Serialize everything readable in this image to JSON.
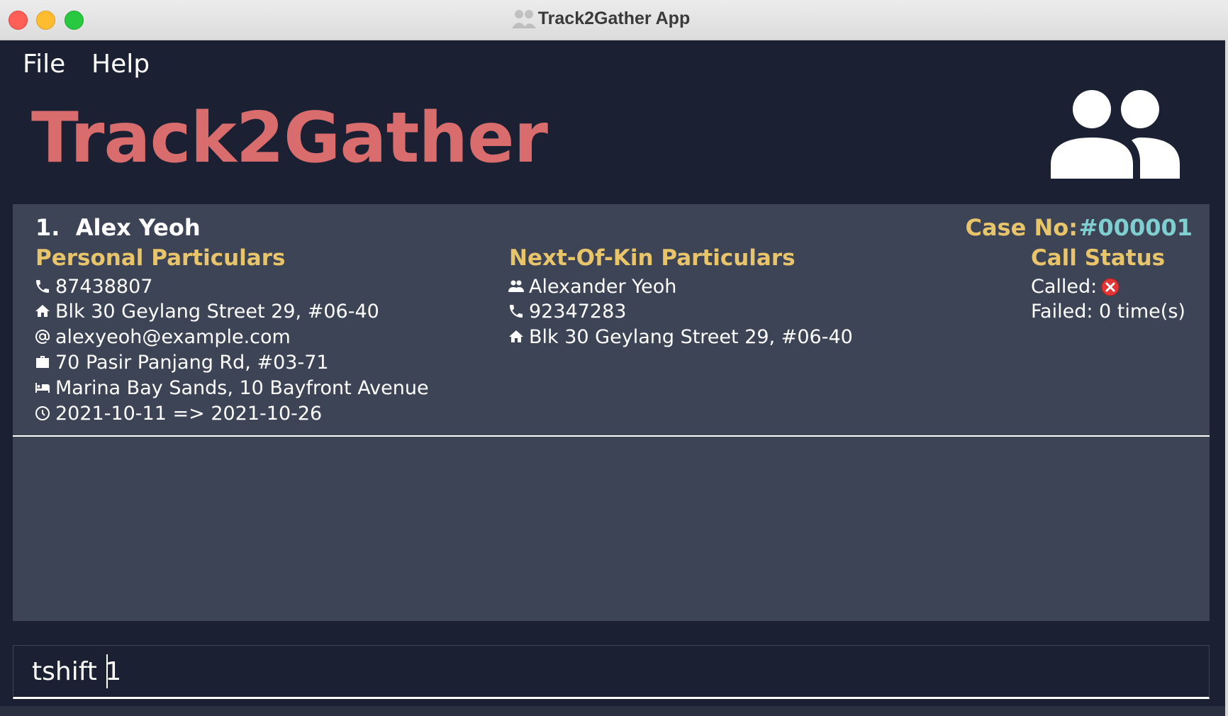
{
  "window": {
    "title": "Track2Gather App"
  },
  "menu": {
    "items": [
      {
        "label": "File"
      },
      {
        "label": "Help"
      }
    ]
  },
  "header": {
    "app_name": "Track2Gather",
    "logo_icon": "people-icon"
  },
  "colors": {
    "background": "#1b2032",
    "panel": "#3d4455",
    "title_red": "#d96d6d",
    "heading_yellow": "#e8c46a",
    "case_teal": "#7fcfd0",
    "status_red": "#e23636"
  },
  "person": {
    "index": "1.",
    "name": "Alex Yeoh",
    "case_label": "Case No:",
    "case_number": "#000001",
    "personal": {
      "heading": "Personal Particulars",
      "phone": "87438807",
      "address": "Blk 30 Geylang Street 29, #06-40",
      "email": "alexyeoh@example.com",
      "work_address": "70 Pasir Panjang Rd, #03-71",
      "quarantine_address": "Marina Bay Sands, 10 Bayfront Avenue",
      "shn_period": "2021-10-11 => 2021-10-26"
    },
    "next_of_kin": {
      "heading": "Next-Of-Kin Particulars",
      "name": "Alexander Yeoh",
      "phone": "92347283",
      "address": "Blk 30 Geylang Street 29, #06-40"
    },
    "call_status": {
      "heading": "Call Status",
      "called_label": "Called:",
      "called_icon": "cross-circle-icon",
      "failed_text": "Failed: 0 time(s)"
    }
  },
  "command": {
    "value": "tshift 1"
  }
}
